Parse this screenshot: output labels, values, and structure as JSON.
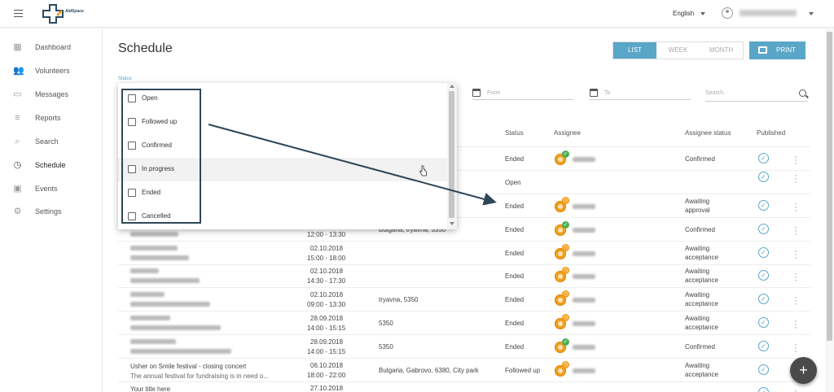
{
  "app": {
    "logo_text": "AidSpace"
  },
  "topbar": {
    "language": "English"
  },
  "sidebar": {
    "items": [
      {
        "label": "Dashboard",
        "icon": "dashboard-icon",
        "glyph": "▦"
      },
      {
        "label": "Volunteers",
        "icon": "people-icon",
        "glyph": "👥"
      },
      {
        "label": "Messages",
        "icon": "message-icon",
        "glyph": "▭"
      },
      {
        "label": "Reports",
        "icon": "reports-icon",
        "glyph": "≡"
      },
      {
        "label": "Search",
        "icon": "search-icon",
        "glyph": "⌕"
      },
      {
        "label": "Schedule",
        "icon": "clock-icon",
        "glyph": "◷"
      },
      {
        "label": "Events",
        "icon": "calendar-icon",
        "glyph": "▣"
      },
      {
        "label": "Settings",
        "icon": "gear-icon",
        "glyph": "⚙"
      }
    ]
  },
  "page": {
    "title": "Schedule"
  },
  "view_toggle": {
    "list": "LIST",
    "week": "WEEK",
    "month": "MONTH"
  },
  "print_label": "PRINT",
  "filters": {
    "status_label": "Status",
    "from_placeholder": "From",
    "to_placeholder": "To",
    "search_placeholder": "Search"
  },
  "status_options": [
    "Open",
    "Followed up",
    "Confirmed",
    "In progress",
    "Ended",
    "Cancelled"
  ],
  "table": {
    "headers": {
      "status": "Status",
      "assignee": "Assignee",
      "assignee_status": "Assignee status",
      "published": "Published"
    },
    "rows": [
      {
        "title": "",
        "subtitle": "",
        "date": "",
        "time": "",
        "location": "",
        "status": "Ended",
        "badge": "ok",
        "assignee_status": "Confirmed"
      },
      {
        "title": "",
        "subtitle": "",
        "date": "",
        "time": "",
        "location": "",
        "status": "Open",
        "badge": "",
        "assignee_status": ""
      },
      {
        "title": "",
        "subtitle": "",
        "date": "",
        "time": "",
        "location": "",
        "status": "Ended",
        "badge": "pending",
        "assignee_status": "Awaiting approval"
      },
      {
        "title": "",
        "subtitle": "",
        "date": "",
        "time": "12:00 - 13:30",
        "location": "Bulgaria, tryavna, 5350",
        "status": "Ended",
        "badge": "ok",
        "assignee_status": "Confirmed"
      },
      {
        "title": "",
        "subtitle": "",
        "date": "02.10.2018",
        "time": "15:00 - 18:00",
        "location": "",
        "status": "Ended",
        "badge": "pending",
        "assignee_status": "Awaiting acceptance"
      },
      {
        "title": "",
        "subtitle": "",
        "date": "02.10.2018",
        "time": "14:30 - 17:30",
        "location": "",
        "status": "Ended",
        "badge": "pending",
        "assignee_status": "Awaiting acceptance"
      },
      {
        "title": "",
        "subtitle": "",
        "date": "02.10.2018",
        "time": "09:00 - 13:30",
        "location": "tryavna, 5350",
        "status": "Ended",
        "badge": "pending",
        "assignee_status": "Awaiting acceptance"
      },
      {
        "title": "",
        "subtitle": "",
        "date": "28.09.2018",
        "time": "14:00 - 15:15",
        "location": "5350",
        "status": "Ended",
        "badge": "pending",
        "assignee_status": "Awaiting acceptance"
      },
      {
        "title": "",
        "subtitle": "",
        "date": "28.09.2018",
        "time": "14:00 - 15:15",
        "location": "5350",
        "status": "Ended",
        "badge": "ok",
        "assignee_status": "Confirmed"
      },
      {
        "title": "Usher on Smile festival - closing concert",
        "subtitle": "The annual festival for fundraising is in need o...",
        "date": "06.10.2018",
        "time": "18:00 - 22:00",
        "location": "Bulgaria, Gabrovo, 6380, City park",
        "status": "Followed up",
        "badge": "pending",
        "assignee_status": "Awaiting acceptance"
      },
      {
        "title": "Your title here",
        "subtitle": "",
        "date": "27.10.2018",
        "time": "",
        "location": "",
        "status": "",
        "badge": "",
        "assignee_status": ""
      }
    ]
  },
  "colors": {
    "accent": "#5aa6c7",
    "annotation": "#2d4756",
    "confirmed": "#4cae4f",
    "pending": "#f29a18"
  }
}
